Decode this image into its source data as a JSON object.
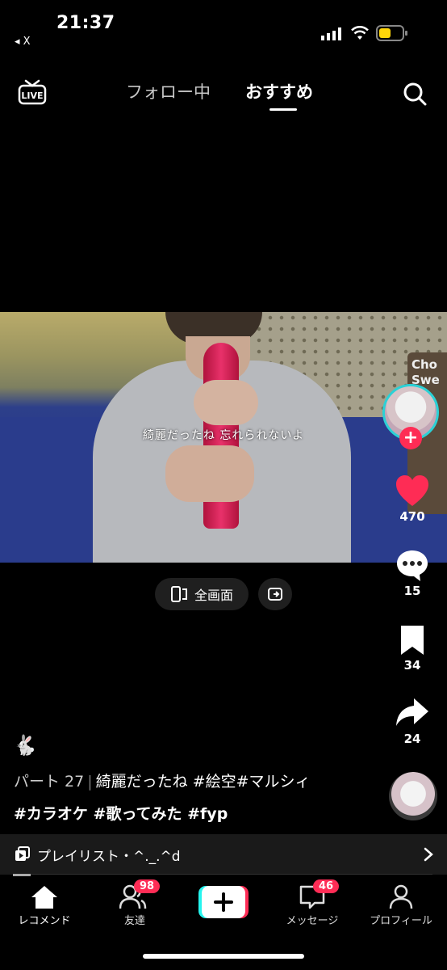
{
  "status_bar": {
    "time": "21:37",
    "back_app": "◂ X"
  },
  "top_nav": {
    "tab_following": "フォロー中",
    "tab_recommended": "おすすめ"
  },
  "video": {
    "lyric_subtitle": "綺麗だったね 忘れられないよ",
    "fullscreen_label": "全画面",
    "box_text": "Cho\nSwe"
  },
  "right_rail": {
    "like_count": "470",
    "comment_count": "15",
    "bookmark_count": "34",
    "share_count": "24"
  },
  "caption": {
    "emoji": "🐇",
    "part": "パート 27",
    "text": "綺麗だったね #絵空#マルシィ",
    "hashtags": "#カラオケ #歌ってみた #fyp"
  },
  "playlist": {
    "label": "プレイリスト・^._.^d"
  },
  "bottom_nav": {
    "home": "レコメンド",
    "friends": "友達",
    "friends_badge": "98",
    "inbox": "メッセージ",
    "inbox_badge": "46",
    "profile": "プロフィール"
  },
  "colors": {
    "accent_red": "#fe2c55",
    "accent_cyan": "#2bd1d6"
  }
}
